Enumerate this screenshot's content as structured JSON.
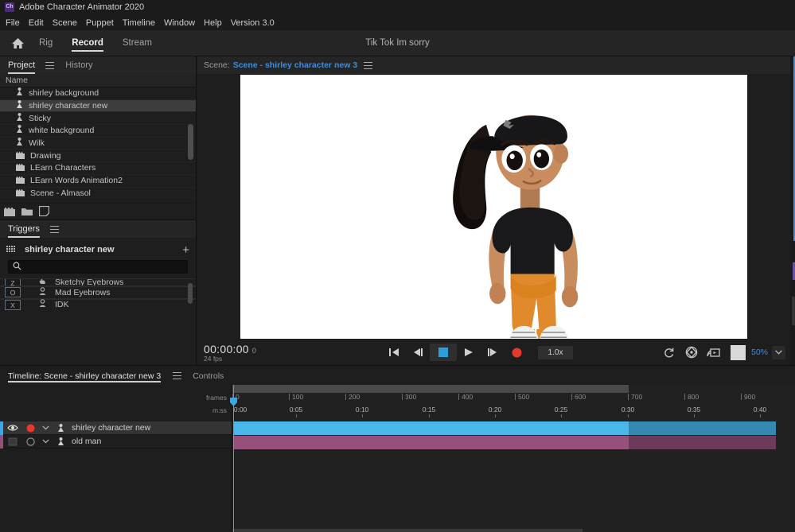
{
  "window": {
    "app_name": "Adobe Character Animator 2020",
    "logo_text": "Ch"
  },
  "menu": {
    "items": [
      "File",
      "Edit",
      "Scene",
      "Puppet",
      "Timeline",
      "Window",
      "Help",
      "Version 3.0"
    ]
  },
  "toolbar": {
    "home_icon": "home-icon",
    "tabs": [
      {
        "label": "Rig",
        "active": false
      },
      {
        "label": "Record",
        "active": true
      },
      {
        "label": "Stream",
        "active": false
      }
    ],
    "document_title": "Tik Tok Im sorry"
  },
  "project_panel": {
    "tabs": [
      {
        "label": "Project",
        "active": true
      },
      {
        "label": "History",
        "active": false
      }
    ],
    "column_header": "Name",
    "items": [
      {
        "name": "shirley background",
        "icon": "puppet-icon",
        "selected": false
      },
      {
        "name": "shirley character new",
        "icon": "puppet-icon",
        "selected": true
      },
      {
        "name": "Sticky",
        "icon": "puppet-icon",
        "selected": false
      },
      {
        "name": "white background",
        "icon": "puppet-icon",
        "selected": false
      },
      {
        "name": "Wilk",
        "icon": "puppet-icon",
        "selected": false
      },
      {
        "name": "Drawing",
        "icon": "scene-icon",
        "selected": false
      },
      {
        "name": "LEarn Characters",
        "icon": "scene-icon",
        "selected": false
      },
      {
        "name": "LEarn Words Animation2",
        "icon": "scene-icon",
        "selected": false
      },
      {
        "name": "Scene - Almasol",
        "icon": "scene-icon",
        "selected": false
      }
    ],
    "footer_icons": [
      "new-scene-icon",
      "new-folder-icon",
      "new-item-icon"
    ]
  },
  "triggers_panel": {
    "tabs": [
      {
        "label": "Triggers",
        "active": true
      }
    ],
    "puppet_name": "shirley character new",
    "add_label": "+",
    "search_placeholder": "",
    "search_value": "",
    "rows": [
      {
        "key": "Z",
        "label": "Sketchy Eyebrows"
      },
      {
        "key": "O",
        "label": "Mad Eyebrows"
      },
      {
        "key": "X",
        "label": "IDK"
      }
    ]
  },
  "scene_panel": {
    "label": "Scene:",
    "name": "Scene - shirley character new 3",
    "timecode": "00:00:00",
    "timecode_sub": "0",
    "fps": "24 fps",
    "transport": [
      {
        "name": "go-to-start-button",
        "glyph": "start"
      },
      {
        "name": "step-back-button",
        "glyph": "stepback"
      },
      {
        "name": "stop-button",
        "glyph": "stop"
      },
      {
        "name": "play-button",
        "glyph": "play"
      },
      {
        "name": "step-forward-button",
        "glyph": "stepfwd"
      },
      {
        "name": "record-button",
        "glyph": "record"
      }
    ],
    "speed": "1.0x",
    "right_icons": [
      "refresh-icon",
      "camera-3d-icon",
      "stream-icon"
    ],
    "background_swatch": "#d9d9d9",
    "zoom_level": "50%",
    "accent_color": "#3f8ddd",
    "stop_color": "#2d9cdb",
    "record_color": "#e23a30"
  },
  "timeline_panel": {
    "tabs": [
      {
        "label": "Timeline: Scene - shirley character new 3",
        "active": true
      },
      {
        "label": "Controls",
        "active": false
      }
    ],
    "ruler": {
      "frames_label": "frames",
      "time_label": "m:ss",
      "frame_ticks": [
        "0",
        "100",
        "200",
        "300",
        "400",
        "500",
        "600",
        "700",
        "800",
        "900"
      ],
      "time_ticks": [
        "0:00",
        "0:05",
        "0:10",
        "0:15",
        "0:20",
        "0:25",
        "0:30",
        "0:35",
        "0:40"
      ]
    },
    "tracks": [
      {
        "name": "shirley character new",
        "visible": true,
        "armed": true,
        "color": "#4bb8ec",
        "color_dim": "#3589b1",
        "chip": "#3aa7e8"
      },
      {
        "name": "old man",
        "visible": false,
        "armed": false,
        "color": "#96507a",
        "color_dim": "#6e3a59",
        "chip": "#96507a"
      }
    ]
  }
}
